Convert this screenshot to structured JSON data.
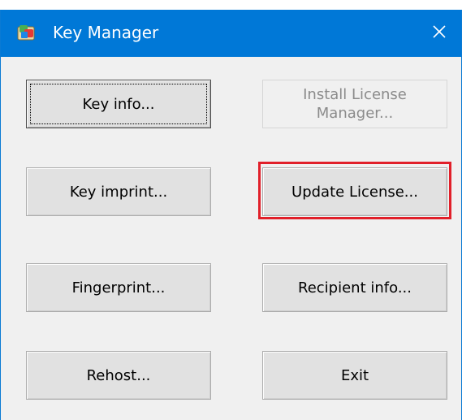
{
  "window": {
    "title": "Key Manager",
    "icon": "key-manager-app-icon",
    "close_icon": "close-icon",
    "titlebar_color": "#0078d7"
  },
  "buttons": {
    "key_info": "Key info...",
    "install_license_manager": "Install License\nManager...",
    "key_imprint": "Key imprint...",
    "update_license": "Update License...",
    "fingerprint": "Fingerprint...",
    "recipient_info": "Recipient info...",
    "rehost": "Rehost...",
    "exit": "Exit"
  },
  "states": {
    "install_license_manager_disabled": true,
    "key_info_focused": true,
    "update_license_highlighted": true,
    "highlight_color": "#e1202a"
  }
}
